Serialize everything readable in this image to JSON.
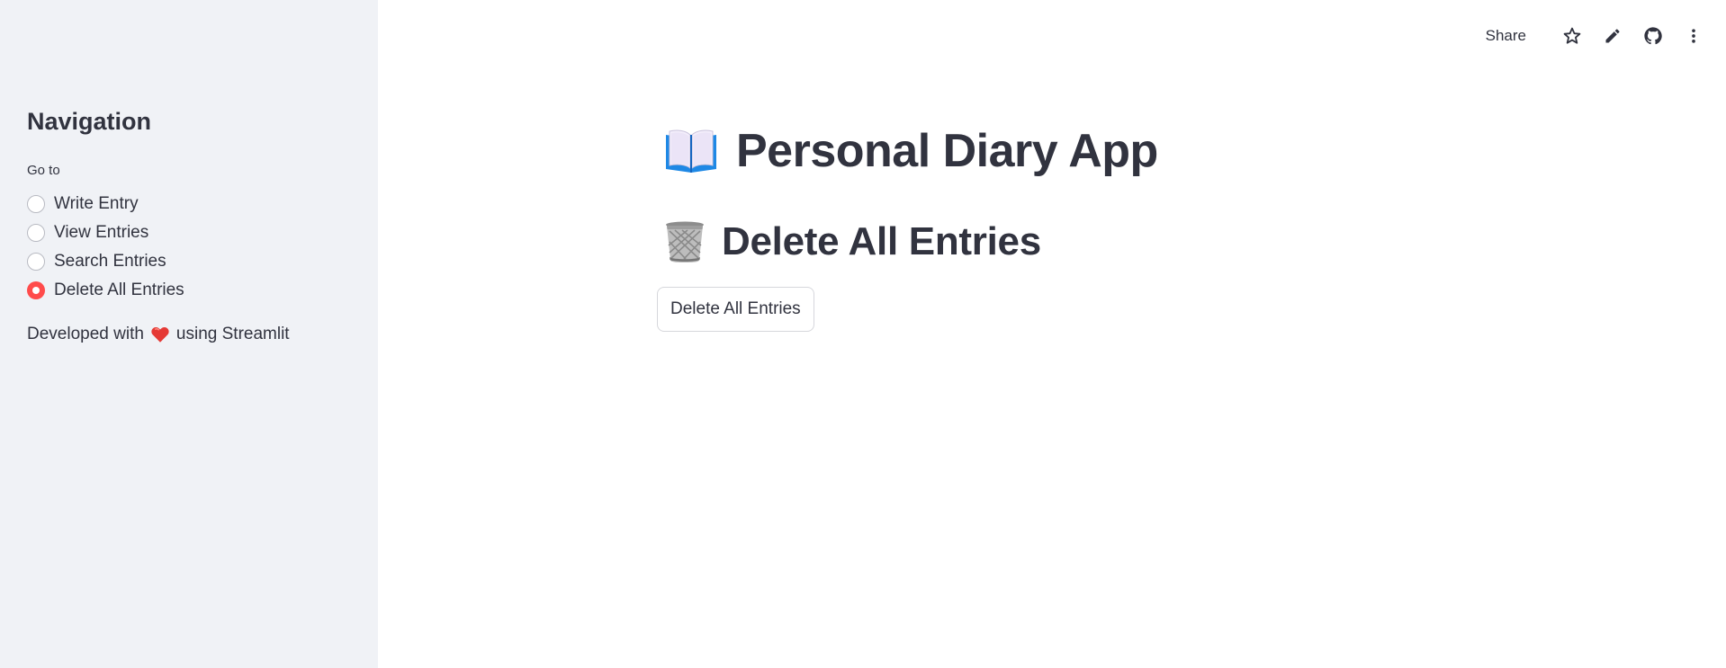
{
  "sidebar": {
    "title": "Navigation",
    "radio_label": "Go to",
    "options": [
      {
        "label": "Write Entry",
        "selected": false
      },
      {
        "label": "View Entries",
        "selected": false
      },
      {
        "label": "Search Entries",
        "selected": false
      },
      {
        "label": "Delete All Entries",
        "selected": true
      }
    ],
    "footer": {
      "before": "Developed with",
      "icon": "heart-icon",
      "after": "using Streamlit"
    }
  },
  "toolbar": {
    "share_label": "Share",
    "icons": [
      "star-icon",
      "pencil-icon",
      "github-icon",
      "more-vertical-icon"
    ]
  },
  "main": {
    "title": "Personal Diary App",
    "title_icon": "open-book-icon",
    "section_title": "Delete All Entries",
    "section_icon": "wastebasket-icon",
    "button_label": "Delete All Entries"
  },
  "colors": {
    "accent": "#ff4b4b",
    "sidebar_bg": "#f0f2f6",
    "text": "#31333f"
  }
}
